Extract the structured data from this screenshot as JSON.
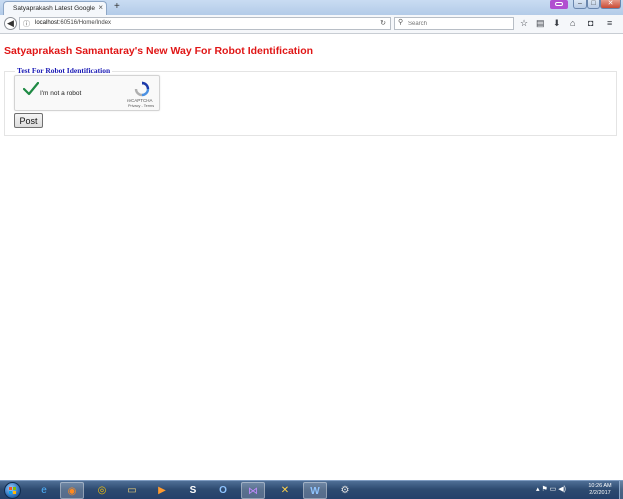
{
  "browser": {
    "tab_title": "Satyaprakash Latest Google Re...",
    "tab_close": "×",
    "new_tab": "+",
    "url_host": "localhost",
    "url_rest": ":60516/Home/Index",
    "search_placeholder": "Search",
    "window_controls": {
      "minimize": "–",
      "maximize": "□",
      "close": "✕"
    }
  },
  "page": {
    "title": "Satyaprakash Samantaray's New Way For Robot Identification",
    "legend": "Test For Robot Identification",
    "recaptcha": {
      "label": "I'm not a robot",
      "brand": "reCAPTCHA",
      "terms": "Privacy - Terms"
    },
    "post_button": "Post"
  },
  "taskbar": {
    "items": [
      "ie-icon",
      "firefox-icon",
      "chrome-icon",
      "explorer-icon",
      "media-player-icon",
      "skype-icon",
      "outlook-icon",
      "visual-studio-icon",
      "tools-icon",
      "word-icon",
      "misc-app-icon"
    ],
    "time": "10:26 AM",
    "date": "2/2/2017"
  },
  "colors": {
    "title_red": "#e01616",
    "legend_blue": "#1a1ab5",
    "check_green": "#1f8a44"
  }
}
